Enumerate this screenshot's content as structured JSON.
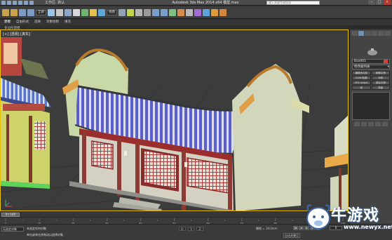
{
  "titlebar": {
    "workspace": "工作区: 默认",
    "title": "Autodesk 3ds Max 2014 x64    模型.max",
    "search_placeholder": "键入关键字或短语"
  },
  "toolbar": {
    "selection_filter": "全部",
    "ref_coord": "视图"
  },
  "ribbon": {
    "tabs": [
      "建模",
      "自由形式",
      "选择",
      "对象绘制",
      "填充"
    ],
    "active_tab": "建模",
    "sub_label": "多边形建模"
  },
  "viewport": {
    "label": "[+] [透视] [真实]"
  },
  "command_panel": {
    "object_name": "Box001",
    "modifier_list": "修改器列表",
    "color": "#e23b3b",
    "modifier_buttons": [
      "编辑多边形",
      "网格平滑",
      "UVW 贴图",
      "对称",
      "FFD 4x4x4",
      "涡轮平滑",
      "壳",
      "弯曲"
    ]
  },
  "timeline": {
    "frame_display": "0 / 100",
    "ticks": [
      "0",
      "10",
      "20",
      "30",
      "40",
      "50",
      "60",
      "70",
      "80",
      "90",
      "100"
    ]
  },
  "statusbar": {
    "selection": "无选定对象",
    "prompt_1": "未选定任何对象",
    "prompt_2": "单击或单击并拖动以选择对象",
    "x": "X:",
    "y": "Y:",
    "z": "Z:",
    "grid": "栅格 = 10.0mm",
    "auto_key": "自动关键点",
    "frame": "0"
  },
  "watermark": {
    "brand": "牛游戏",
    "url": "www.newyx.net"
  },
  "icons": [
    "undo-icon",
    "redo-icon",
    "select-icon",
    "move-icon",
    "rotate-icon",
    "scale-icon",
    "snap-icon",
    "render-icon",
    "teapot-icon"
  ]
}
